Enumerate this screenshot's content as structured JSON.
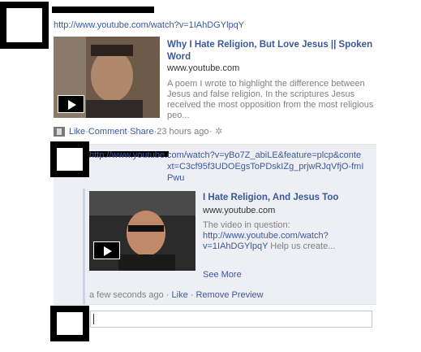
{
  "post": {
    "url_text": "http://www.youtube.com/watch?v=1IAhDGYlpqY",
    "attachment": {
      "title": "Why I Hate Religion, But Love Jesus || Spoken Word",
      "domain": "www.youtube.com",
      "description": "A poem I wrote to highlight the difference between Jesus and false religion. In the scriptures Jesus received the most opposition from the most religious peo..."
    },
    "actions": {
      "like": "Like",
      "sep1": " · ",
      "comment": "Comment",
      "sep2": " · ",
      "share": "Share",
      "sep3": " · ",
      "timestamp": "23 hours ago",
      "sep4": " · "
    }
  },
  "comment": {
    "text": "http://www.youtube.com/watch?v=yBo7Z_abiLE&feature=plcp&context=C3cf95f3UDOEgsToPDskIZg_prjwRJqVfjO-fmIPwu",
    "preview": {
      "title": "I Hate Religion, And Jesus Too",
      "domain": "www.youtube.com",
      "desc_prefix": "The video in question: ",
      "desc_link": "http://www.youtube.com/watch?v=1IAhDGYlpqY",
      "desc_suffix": " Help us create...",
      "see_more": "See More"
    },
    "meta": {
      "time": "a few seconds ago",
      "sep1": " · ",
      "like": "Like",
      "sep2": " · ",
      "remove": "Remove Preview"
    }
  },
  "icons": {
    "video": "film-icon",
    "settings": "gear-icon"
  },
  "colors": {
    "link": "#3b5998",
    "muted": "#808080",
    "comment_bg": "#edeff4"
  }
}
